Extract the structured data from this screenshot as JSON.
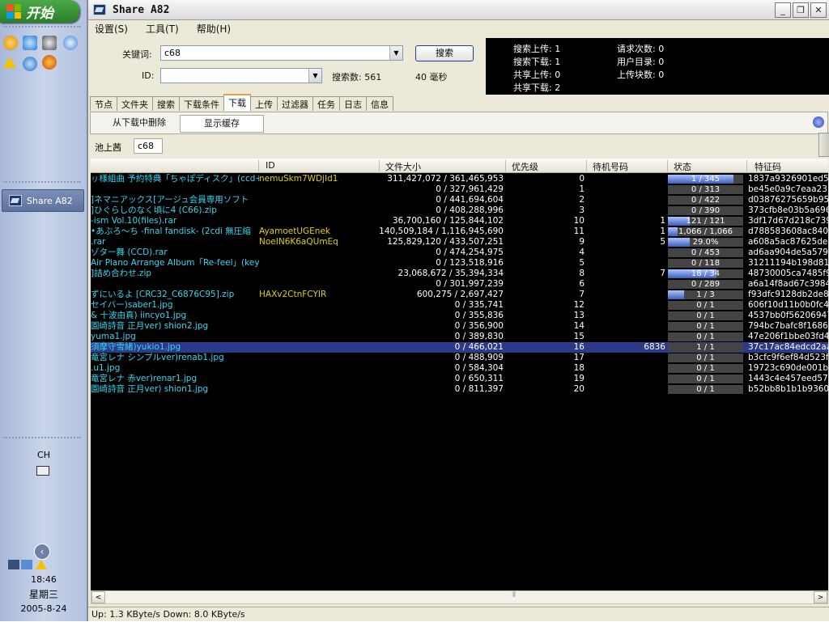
{
  "taskbar": {
    "start_label": "开始",
    "task_button_label": "Share A82",
    "ime": "CH",
    "time": "18:46",
    "weekday": "星期三",
    "date": "2005-8-24"
  },
  "window": {
    "title": "Share A82",
    "minimize": "_",
    "restore": "❐",
    "close": "✕"
  },
  "menu": [
    {
      "label": "设置(S)"
    },
    {
      "label": "工具(T)"
    },
    {
      "label": "帮助(H)"
    }
  ],
  "search": {
    "keyword_label": "关键词:",
    "keyword_value": "c68",
    "id_label": "ID:",
    "id_value": "",
    "search_button": "搜索",
    "result_count": "搜索数: 561",
    "elapsed": "40 毫秒"
  },
  "stats": {
    "search_upload": "搜索上传: 1",
    "search_download": "搜索下载: 1",
    "share_upload": "共享上传: 0",
    "share_download": "共享下载: 2",
    "request_count": "请求次数: 0",
    "user_dirs": "用户目录: 0",
    "upload_blocks": "上传块数: 0"
  },
  "tabs": [
    {
      "label": "节点"
    },
    {
      "label": "文件夹"
    },
    {
      "label": "搜索"
    },
    {
      "label": "下载条件"
    },
    {
      "label": "下载",
      "active": true
    },
    {
      "label": "上传"
    },
    {
      "label": "过滤器"
    },
    {
      "label": "任务"
    },
    {
      "label": "日志"
    },
    {
      "label": "信息"
    }
  ],
  "toolbar": {
    "delete_label": "从下载中删除",
    "show_cache_label": "显示缓存"
  },
  "filter": {
    "tag1": "池上茜",
    "tag2": "c68"
  },
  "columns": {
    "id": "ID",
    "size": "文件大小",
    "priority": "优先级",
    "queue": "待机号码",
    "status": "状态",
    "hash": "特征码"
  },
  "rows": [
    {
      "name": "ㇼ様組曲 予約特典「ちゃぽディスク」(ccd+",
      "id": "nemuSkm7WDjId1",
      "size": "311,427,072 / 361,465,953",
      "priority": "0",
      "queue": "",
      "status": "1 / 345",
      "progress": 0.87,
      "hash": "1837a9326901ed52"
    },
    {
      "name": "",
      "id": "",
      "size": "0 / 327,961,429",
      "priority": "1",
      "queue": "",
      "status": "0 / 313",
      "progress": 0,
      "hash": "be45e0a9c7eaa235"
    },
    {
      "name": "]ネマニアックス[アージュ会員専用ソフト",
      "id": "",
      "size": "0 / 441,694,604",
      "priority": "2",
      "queue": "",
      "status": "0 / 422",
      "progress": 0,
      "hash": "d03876275659b95b"
    },
    {
      "name": "]ひぐらしのなく頃に4 (C66).zip",
      "id": "",
      "size": "0 / 408,288,996",
      "priority": "3",
      "queue": "",
      "status": "0 / 390",
      "progress": 0,
      "hash": "373cfb8e03b5a696"
    },
    {
      "name": "-ism Vol.10(files).rar",
      "id": "",
      "size": "36,700,160 / 125,844,102",
      "priority": "10",
      "queue": "1",
      "status": "121 / 121",
      "progress": 0.29,
      "hash": "3df17d67d218c739"
    },
    {
      "name": "•あぶろ～ち -final fandisk- (2cdi 無圧縮",
      "id": "AyamoetUGEnek",
      "size": "140,509,184 / 1,116,945,690",
      "priority": "11",
      "queue": "1",
      "status": "1,066 / 1,066",
      "progress": 0.13,
      "hash": "d788583608ac8400"
    },
    {
      "name": ".rar",
      "id": "NoeIN6K6aQUmEq",
      "size": "125,829,120 / 433,507,251",
      "priority": "9",
      "queue": "5",
      "status": "29.0%",
      "progress": 0.29,
      "hash": "a608a5ac87625de2"
    },
    {
      "name": "ゾター舞 (CCD).rar",
      "id": "",
      "size": "0 / 474,254,975",
      "priority": "4",
      "queue": "",
      "status": "0 / 453",
      "progress": 0,
      "hash": "ad6aa904de5a5796"
    },
    {
      "name": "Air Piano Arrange Album「Re-feel」(key／",
      "id": "",
      "size": "0 / 123,518,916",
      "priority": "5",
      "queue": "",
      "status": "0 / 118",
      "progress": 0,
      "hash": "31211194b198d819"
    },
    {
      "name": "]詰め合わせ.zip",
      "id": "",
      "size": "23,068,672 / 35,394,334",
      "priority": "8",
      "queue": "7",
      "status": "18 / 34",
      "progress": 0.65,
      "hash": "48730005ca7485f9"
    },
    {
      "name": "",
      "id": "",
      "size": "0 / 301,997,239",
      "priority": "6",
      "queue": "",
      "status": "0 / 289",
      "progress": 0,
      "hash": "a6a14f8ad67c3984"
    },
    {
      "name": "ずにいるよ [CRC32_C6876C95].zip",
      "id": "HAXv2CtnFCYIR",
      "size": "600,275 / 2,697,427",
      "priority": "7",
      "queue": "",
      "status": "1 / 3",
      "progress": 0.22,
      "hash": "f93dfc9128db2de84"
    },
    {
      "name": "セイバー)saber1.jpg",
      "id": "",
      "size": "0 / 335,741",
      "priority": "12",
      "queue": "",
      "status": "0 / 1",
      "progress": 0,
      "hash": "606f10d11b0b0fc45"
    },
    {
      "name": "& 十波由真) iincyo1.jpg",
      "id": "",
      "size": "0 / 355,836",
      "priority": "13",
      "queue": "",
      "status": "0 / 1",
      "progress": 0,
      "hash": "4537bb0f56206947"
    },
    {
      "name": "園崎詩音 正月ver) shion2.jpg",
      "id": "",
      "size": "0 / 356,900",
      "priority": "14",
      "queue": "",
      "status": "0 / 1",
      "progress": 0,
      "hash": "794bc7bafc8f16865"
    },
    {
      "name": " yuma1.jpg",
      "id": "",
      "size": "0 / 389,830",
      "priority": "15",
      "queue": "",
      "status": "0 / 1",
      "progress": 0,
      "hash": "47e206f1bbe03fd43"
    },
    {
      "name": "須摩守雪緒)yukio1.jpg",
      "id": "",
      "size": "0 / 466,021",
      "priority": "16",
      "queue": "6836",
      "status": "1 / 1",
      "progress": 0,
      "hash": "37c17ac84edcd2aa",
      "selected": true
    },
    {
      "name": "竜宮レナ シンプルver)renab1.jpg",
      "id": "",
      "size": "0 / 488,909",
      "priority": "17",
      "queue": "",
      "status": "0 / 1",
      "progress": 0,
      "hash": "b3cfc9f6ef84d523f"
    },
    {
      "name": ".u1.jpg",
      "id": "",
      "size": "0 / 584,304",
      "priority": "18",
      "queue": "",
      "status": "0 / 1",
      "progress": 0,
      "hash": "19723c690de001b8"
    },
    {
      "name": "竜宮レナ 赤ver)renar1.jpg",
      "id": "",
      "size": "0 / 650,311",
      "priority": "19",
      "queue": "",
      "status": "0 / 1",
      "progress": 0,
      "hash": "1443c4e457eed57d"
    },
    {
      "name": "園崎詩音 正月ver) shion1.jpg",
      "id": "",
      "size": "0 / 811,397",
      "priority": "20",
      "queue": "",
      "status": "0 / 1",
      "progress": 0,
      "hash": "b52bb8b1b1b9360d"
    }
  ],
  "scroll": {
    "left": "<",
    "right": ">",
    "thumb": "⦀"
  },
  "statusbar": "Up: 1.3 KByte/s Down: 8.0 KByte/s",
  "colors": {
    "name_text": "#36d6f0",
    "id_text": "#e0d000",
    "grid_bg": "#000000",
    "selected_row": "#2c3a8a",
    "progress_fill": "#3c5fb8",
    "start_button": "#3c9a3a"
  }
}
